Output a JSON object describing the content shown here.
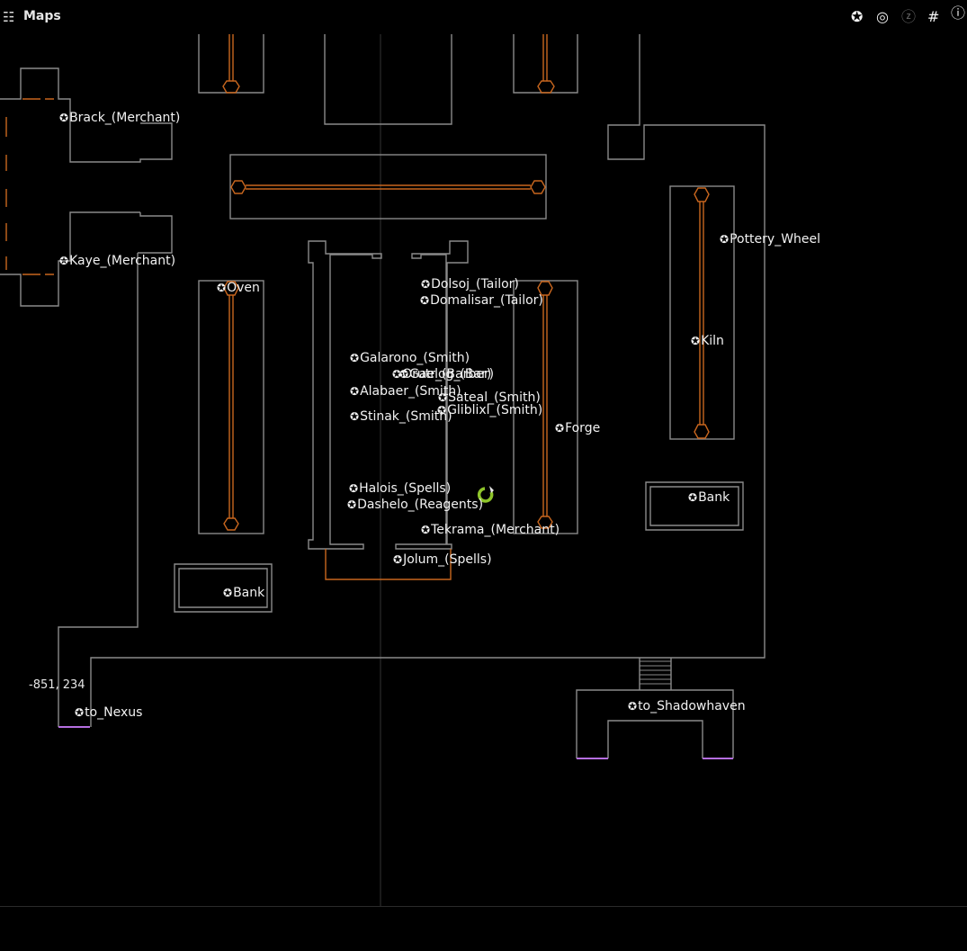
{
  "header": {
    "menu_icon": "☷",
    "title": "Maps",
    "tools": [
      {
        "name": "poi-filter-icon",
        "glyph": "✪"
      },
      {
        "name": "target-icon",
        "glyph": "◎"
      },
      {
        "name": "sleep-icon",
        "glyph": "ⓩ"
      },
      {
        "name": "grid-icon",
        "glyph": "#"
      },
      {
        "name": "info-icon",
        "glyph": "ⓘ"
      }
    ]
  },
  "map": {
    "coordinates": "-851, 234",
    "colors": {
      "wall": "#8a8a8a",
      "furniture": "#c8661e",
      "exit": "#b56ee0",
      "player": "#8ec42a"
    },
    "pois": [
      {
        "label": "Brack_(Merchant)"
      },
      {
        "label": "Kaye_(Merchant)"
      },
      {
        "label": "Oven"
      },
      {
        "label": "Pottery_Wheel"
      },
      {
        "label": "Dolsoj_(Tailor)"
      },
      {
        "label": "Domalisar_(Tailor)"
      },
      {
        "label": "Kiln"
      },
      {
        "label": "Galarono_(Smith)"
      },
      {
        "label": "Orutr_(Barber)"
      },
      {
        "label": "Gaelog_(Bar)"
      },
      {
        "label": "Alabaer_(Smith)"
      },
      {
        "label": "Sateal_(Smith)"
      },
      {
        "label": "Gliblixl_(Smith)"
      },
      {
        "label": "Stinak_(Smith)"
      },
      {
        "label": "Forge"
      },
      {
        "label": "Halois_(Spells)"
      },
      {
        "label": "Dashelo_(Reagents)"
      },
      {
        "label": "Bank"
      },
      {
        "label": "Tekrama_(Merchant)"
      },
      {
        "label": "Jolum_(Spells)"
      },
      {
        "label": "Bank"
      },
      {
        "label": "to_Nexus"
      },
      {
        "label": "to_Shadowhaven"
      }
    ]
  }
}
